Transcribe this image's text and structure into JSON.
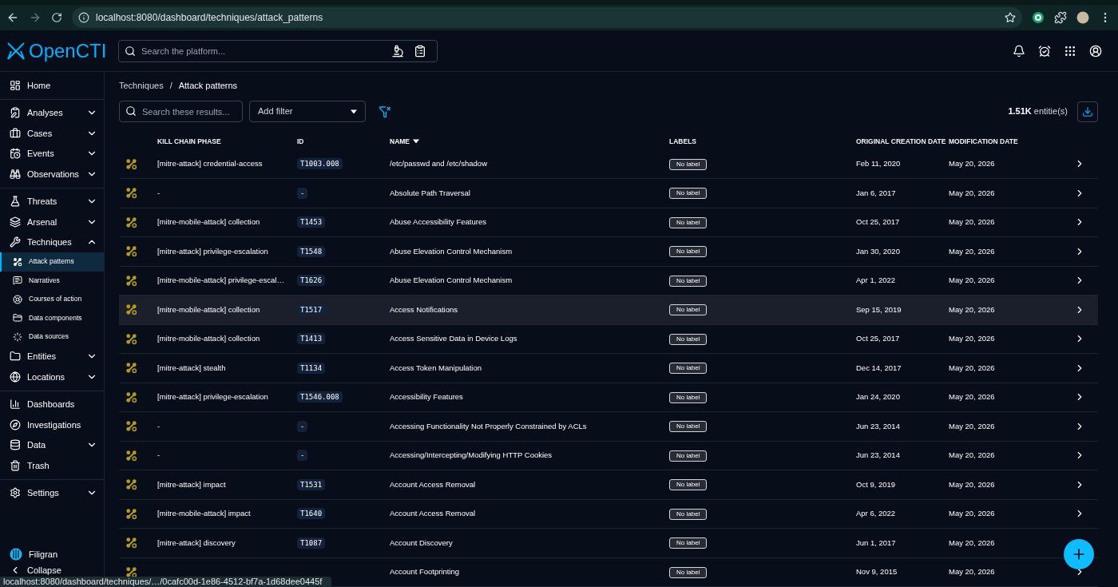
{
  "browser": {
    "url": "localhost:8080/dashboard/techniques/attack_patterns",
    "status_url": "localhost:8080/dashboard/techniques/…/0cafc00d-1e86-4512-bf7a-1d68dee0445f"
  },
  "topbar": {
    "logo": "OpenCTI",
    "search": {
      "placeholder": "Search the platform..."
    }
  },
  "sidebar": {
    "groups": [
      [
        {
          "label": "Home",
          "selected": false
        }
      ],
      [
        {
          "label": "Analyses",
          "selected": false,
          "expanded": false
        },
        {
          "label": "Cases",
          "selected": false,
          "expanded": false
        },
        {
          "label": "Events",
          "selected": false,
          "expanded": false
        },
        {
          "label": "Observations",
          "selected": false,
          "expanded": false
        }
      ],
      [
        {
          "label": "Threats",
          "selected": false,
          "expanded": false
        },
        {
          "label": "Arsenal",
          "selected": false,
          "expanded": false
        },
        {
          "label": "Techniques",
          "selected": false,
          "expanded": true,
          "children": [
            {
              "label": "Attack patterns",
              "selected": true
            },
            {
              "label": "Narratives",
              "selected": false
            },
            {
              "label": "Courses of action",
              "selected": false
            },
            {
              "label": "Data components",
              "selected": false
            },
            {
              "label": "Data sources",
              "selected": false
            }
          ]
        },
        {
          "label": "Entities",
          "selected": false,
          "expanded": false
        },
        {
          "label": "Locations",
          "selected": false,
          "expanded": false
        }
      ],
      [
        {
          "label": "Dashboards",
          "selected": false
        },
        {
          "label": "Investigations",
          "selected": false
        },
        {
          "label": "Data",
          "selected": false,
          "expanded": false
        },
        {
          "label": "Trash",
          "selected": false
        }
      ],
      [
        {
          "label": "Settings",
          "selected": false,
          "expanded": false
        }
      ]
    ],
    "brand": "Filigran",
    "collapse": "Collapse"
  },
  "breadcrumb": {
    "items": [
      "Techniques",
      "Attack patterns"
    ],
    "separator": "/"
  },
  "toolbar": {
    "search": {
      "placeholder": "Search these results..."
    },
    "filter": {
      "placeholder": "Add filter"
    },
    "count": "1.51K",
    "count_unit": "entitie(s)"
  },
  "table": {
    "columns": [
      {
        "label": "KILL CHAIN PHASE",
        "sorted": false
      },
      {
        "label": "ID",
        "sorted": false
      },
      {
        "label": "NAME",
        "sorted": true
      },
      {
        "label": "LABELS",
        "sorted": false
      },
      {
        "label": "ORIGINAL CREATION DATE",
        "sorted": false
      },
      {
        "label": "MODIFICATION DATE",
        "sorted": false
      }
    ],
    "rows": [
      {
        "phase": "[mitre-attack] credential-access",
        "id": "T1003.008",
        "name": "/etc/passwd and /etc/shadow",
        "label": "No label",
        "created": "Feb 11, 2020",
        "modified": "May 20, 2026",
        "hovered": false
      },
      {
        "phase": "-",
        "id": "-",
        "name": "Absolute Path Traversal",
        "label": "No label",
        "created": "Jan 6, 2017",
        "modified": "May 20, 2026",
        "hovered": false
      },
      {
        "phase": "[mitre-mobile-attack] collection",
        "id": "T1453",
        "name": "Abuse Accessibility Features",
        "label": "No label",
        "created": "Oct 25, 2017",
        "modified": "May 20, 2026",
        "hovered": false
      },
      {
        "phase": "[mitre-attack] privilege-escalation",
        "id": "T1548",
        "name": "Abuse Elevation Control Mechanism",
        "label": "No label",
        "created": "Jan 30, 2020",
        "modified": "May 20, 2026",
        "hovered": false
      },
      {
        "phase": "[mitre-mobile-attack] privilege-escal…",
        "id": "T1626",
        "name": "Abuse Elevation Control Mechanism",
        "label": "No label",
        "created": "Apr 1, 2022",
        "modified": "May 20, 2026",
        "hovered": false
      },
      {
        "phase": "[mitre-mobile-attack] collection",
        "id": "T1517",
        "name": "Access Notifications",
        "label": "No label",
        "created": "Sep 15, 2019",
        "modified": "May 20, 2026",
        "hovered": true
      },
      {
        "phase": "[mitre-mobile-attack] collection",
        "id": "T1413",
        "name": "Access Sensitive Data in Device Logs",
        "label": "No label",
        "created": "Oct 25, 2017",
        "modified": "May 20, 2026",
        "hovered": false
      },
      {
        "phase": "[mitre-attack] stealth",
        "id": "T1134",
        "name": "Access Token Manipulation",
        "label": "No label",
        "created": "Dec 14, 2017",
        "modified": "May 20, 2026",
        "hovered": false
      },
      {
        "phase": "[mitre-attack] privilege-escalation",
        "id": "T1546.008",
        "name": "Accessibility Features",
        "label": "No label",
        "created": "Jan 24, 2020",
        "modified": "May 20, 2026",
        "hovered": false
      },
      {
        "phase": "-",
        "id": "-",
        "name": "Accessing Functionality Not Properly Constrained by ACLs",
        "label": "No label",
        "created": "Jun 23, 2014",
        "modified": "May 20, 2026",
        "hovered": false
      },
      {
        "phase": "-",
        "id": "-",
        "name": "Accessing/Intercepting/Modifying HTTP Cookies",
        "label": "No label",
        "created": "Jun 23, 2014",
        "modified": "May 20, 2026",
        "hovered": false
      },
      {
        "phase": "[mitre-attack] impact",
        "id": "T1531",
        "name": "Account Access Removal",
        "label": "No label",
        "created": "Oct 9, 2019",
        "modified": "May 20, 2026",
        "hovered": false
      },
      {
        "phase": "[mitre-mobile-attack] impact",
        "id": "T1640",
        "name": "Account Access Removal",
        "label": "No label",
        "created": "Apr 6, 2022",
        "modified": "May 20, 2026",
        "hovered": false
      },
      {
        "phase": "[mitre-attack] discovery",
        "id": "T1087",
        "name": "Account Discovery",
        "label": "No label",
        "created": "Jun 1, 2017",
        "modified": "May 20, 2026",
        "hovered": false
      },
      {
        "name": "Account Footprinting",
        "label": "No label",
        "created": "Nov 9, 2015",
        "modified": "May 20, 2026",
        "hovered": false
      }
    ]
  }
}
